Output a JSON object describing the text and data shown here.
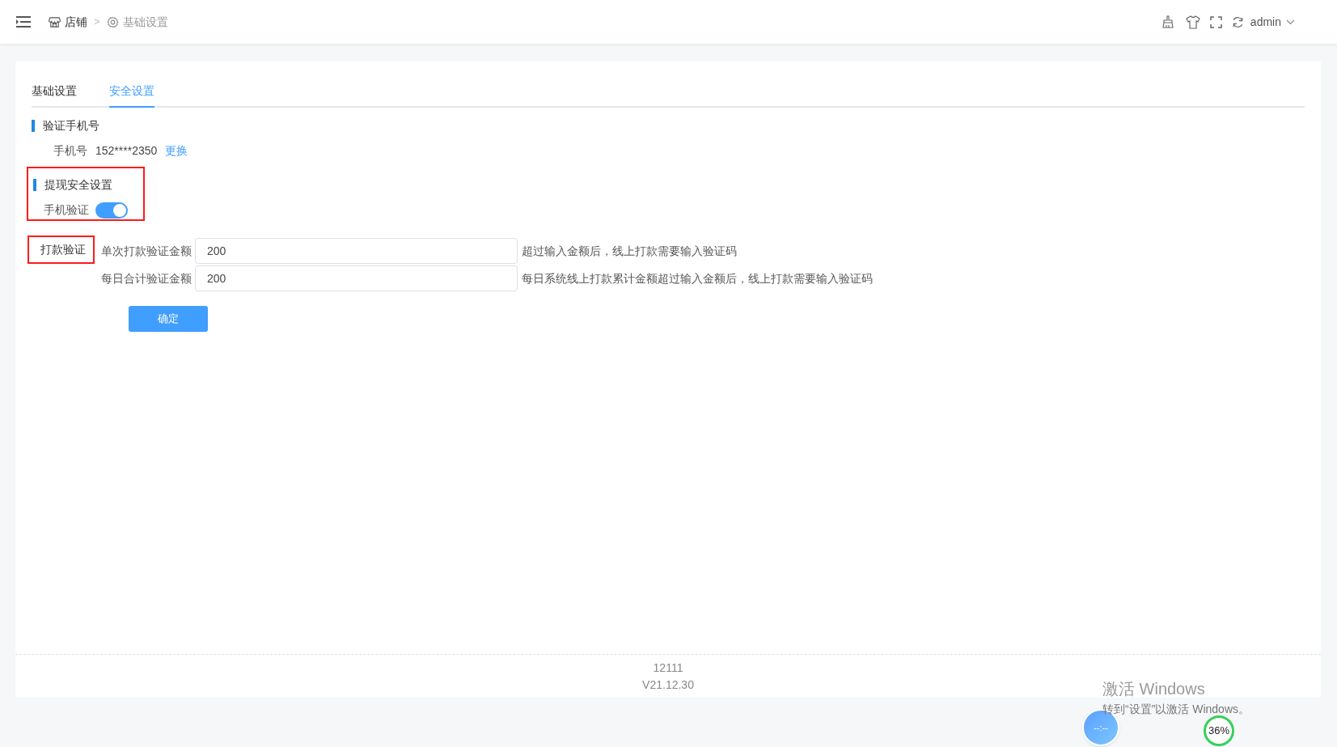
{
  "breadcrumb": [
    "店铺",
    "基础设置"
  ],
  "breadcrumb_separator": ">",
  "user": "admin",
  "tabs": [
    {
      "label": "基础设置",
      "selected": false
    },
    {
      "label": "安全设置",
      "selected": true
    }
  ],
  "phone_section": {
    "title": "验证手机号",
    "label": "手机号",
    "value": "152****2350",
    "link": "更换"
  },
  "withdraw_section": {
    "title": "提现安全设置",
    "toggle_label": "手机验证",
    "on": true
  },
  "payment_section": {
    "label": "打款验证",
    "rows": [
      {
        "label": "单次打款验证金额",
        "value": "200",
        "hint": "超过输入金额后，线上打款需要输入验证码"
      },
      {
        "label": "每日合计验证金额",
        "value": "200",
        "hint": "每日系统线上打款累计金额超过输入金额后，线上打款需要输入验证码"
      }
    ]
  },
  "confirm_button": "确定",
  "footer": [
    "12111",
    "V21.12.30"
  ],
  "overlay": {
    "activation_title": "激活 Windows",
    "activation_text": "转到“设置”以激活 Windows。",
    "clock": "--:--",
    "percent": "36%"
  }
}
